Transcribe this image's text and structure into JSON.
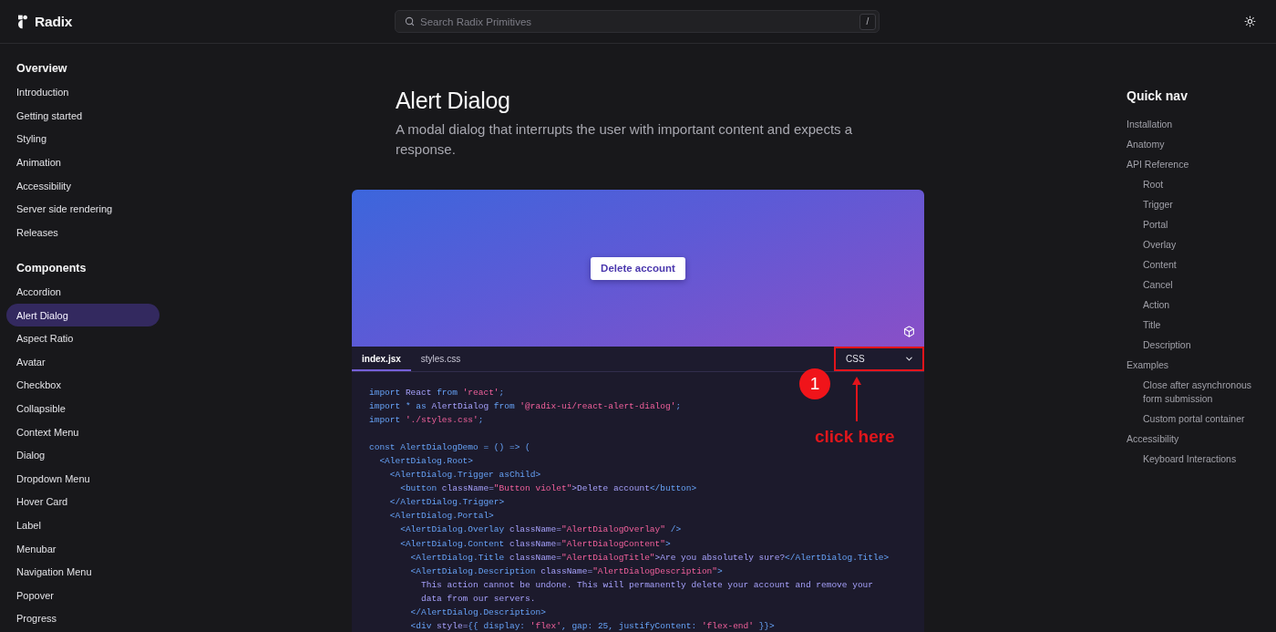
{
  "header": {
    "logo": "Radix",
    "search": {
      "placeholder": "Search Radix Primitives",
      "shortcut": "/"
    }
  },
  "sidebar": {
    "sections": [
      {
        "heading": "Overview",
        "items": [
          {
            "label": "Introduction",
            "selected": false
          },
          {
            "label": "Getting started",
            "selected": false
          },
          {
            "label": "Styling",
            "selected": false
          },
          {
            "label": "Animation",
            "selected": false
          },
          {
            "label": "Accessibility",
            "selected": false
          },
          {
            "label": "Server side rendering",
            "selected": false
          },
          {
            "label": "Releases",
            "selected": false
          }
        ]
      },
      {
        "heading": "Components",
        "items": [
          {
            "label": "Accordion",
            "selected": false
          },
          {
            "label": "Alert Dialog",
            "selected": true
          },
          {
            "label": "Aspect Ratio",
            "selected": false
          },
          {
            "label": "Avatar",
            "selected": false
          },
          {
            "label": "Checkbox",
            "selected": false
          },
          {
            "label": "Collapsible",
            "selected": false
          },
          {
            "label": "Context Menu",
            "selected": false
          },
          {
            "label": "Dialog",
            "selected": false
          },
          {
            "label": "Dropdown Menu",
            "selected": false
          },
          {
            "label": "Hover Card",
            "selected": false
          },
          {
            "label": "Label",
            "selected": false
          },
          {
            "label": "Menubar",
            "selected": false
          },
          {
            "label": "Navigation Menu",
            "selected": false
          },
          {
            "label": "Popover",
            "selected": false
          },
          {
            "label": "Progress",
            "selected": false
          }
        ]
      }
    ]
  },
  "page": {
    "title": "Alert Dialog",
    "description": "A modal dialog that interrupts the user with important content and expects a response."
  },
  "demo": {
    "button": "Delete account"
  },
  "code": {
    "tabs": [
      {
        "label": "index.jsx",
        "selected": true
      },
      {
        "label": "styles.css",
        "selected": false
      }
    ],
    "style_select": "CSS",
    "blocks": [
      [
        [
          {
            "kind": "plain",
            "text": "import"
          },
          {
            "kind": "attr",
            "text": " React "
          },
          {
            "kind": "plain",
            "text": "from "
          },
          {
            "kind": "string",
            "text": "'react'"
          },
          {
            "kind": "plain",
            "text": ";"
          }
        ],
        [
          {
            "kind": "plain",
            "text": "import * as"
          },
          {
            "kind": "attr",
            "text": " AlertDialog "
          },
          {
            "kind": "plain",
            "text": "from "
          },
          {
            "kind": "string",
            "text": "'@radix-ui/react-alert-dialog'"
          },
          {
            "kind": "plain",
            "text": ";"
          }
        ],
        [
          {
            "kind": "plain",
            "text": "import "
          },
          {
            "kind": "string",
            "text": "'./styles.css'"
          },
          {
            "kind": "plain",
            "text": ";"
          }
        ]
      ],
      [
        [
          {
            "kind": "plain",
            "text": "const AlertDialogDemo = () => ("
          }
        ],
        [
          {
            "kind": "plain",
            "text": "  <AlertDialog.Root>"
          }
        ],
        [
          {
            "kind": "plain",
            "text": "    <AlertDialog.Trigger asChild>"
          }
        ],
        [
          {
            "kind": "plain",
            "text": "      <button"
          },
          {
            "kind": "attr",
            "text": " className="
          },
          {
            "kind": "string",
            "text": "\"Button violet\""
          },
          {
            "kind": "attr",
            "text": ">Delete account"
          },
          {
            "kind": "plain",
            "text": "</button>"
          }
        ],
        [
          {
            "kind": "plain",
            "text": "    </AlertDialog.Trigger>"
          }
        ],
        [
          {
            "kind": "plain",
            "text": "    <AlertDialog.Portal>"
          }
        ],
        [
          {
            "kind": "plain",
            "text": "      <AlertDialog.Overlay"
          },
          {
            "kind": "attr",
            "text": " className="
          },
          {
            "kind": "string",
            "text": "\"AlertDialogOverlay\""
          },
          {
            "kind": "plain",
            "text": " />"
          }
        ],
        [
          {
            "kind": "plain",
            "text": "      <AlertDialog.Content"
          },
          {
            "kind": "attr",
            "text": " className="
          },
          {
            "kind": "string",
            "text": "\"AlertDialogContent\""
          },
          {
            "kind": "plain",
            "text": ">"
          }
        ],
        [
          {
            "kind": "plain",
            "text": "        <AlertDialog.Title"
          },
          {
            "kind": "attr",
            "text": " className="
          },
          {
            "kind": "string",
            "text": "\"AlertDialogTitle\""
          },
          {
            "kind": "attr",
            "text": ">Are you absolutely sure?"
          },
          {
            "kind": "plain",
            "text": "</AlertDialog.Title>"
          }
        ],
        [
          {
            "kind": "plain",
            "text": "        <AlertDialog.Description"
          },
          {
            "kind": "attr",
            "text": " className="
          },
          {
            "kind": "string",
            "text": "\"AlertDialogDescription\""
          },
          {
            "kind": "plain",
            "text": ">"
          }
        ],
        [
          {
            "kind": "attr",
            "text": "          This action cannot be undone. This will permanently delete your account and remove your"
          }
        ],
        [
          {
            "kind": "attr",
            "text": "          data from our servers."
          }
        ],
        [
          {
            "kind": "plain",
            "text": "        </AlertDialog.Description>"
          }
        ],
        [
          {
            "kind": "plain",
            "text": "        <div"
          },
          {
            "kind": "attr",
            "text": " style="
          },
          {
            "kind": "plain",
            "text": "{{ display: "
          },
          {
            "kind": "string",
            "text": "'flex'"
          },
          {
            "kind": "plain",
            "text": ", gap: 25, justifyContent: "
          },
          {
            "kind": "string",
            "text": "'flex-end'"
          },
          {
            "kind": "plain",
            "text": " }}>"
          }
        ]
      ]
    ]
  },
  "annotation": {
    "step": "1",
    "caption": "click here"
  },
  "quick_nav": {
    "title": "Quick nav",
    "items": [
      {
        "label": "Installation"
      },
      {
        "label": "Anatomy"
      },
      {
        "label": "API Reference",
        "children": [
          {
            "label": "Root"
          },
          {
            "label": "Trigger"
          },
          {
            "label": "Portal"
          },
          {
            "label": "Overlay"
          },
          {
            "label": "Content"
          },
          {
            "label": "Cancel"
          },
          {
            "label": "Action"
          },
          {
            "label": "Title"
          },
          {
            "label": "Description"
          }
        ]
      },
      {
        "label": "Examples",
        "children": [
          {
            "label": "Close after asynchronous form submission"
          },
          {
            "label": "Custom portal container"
          }
        ]
      },
      {
        "label": "Accessibility",
        "children": [
          {
            "label": "Keyboard Interactions"
          }
        ]
      }
    ]
  }
}
